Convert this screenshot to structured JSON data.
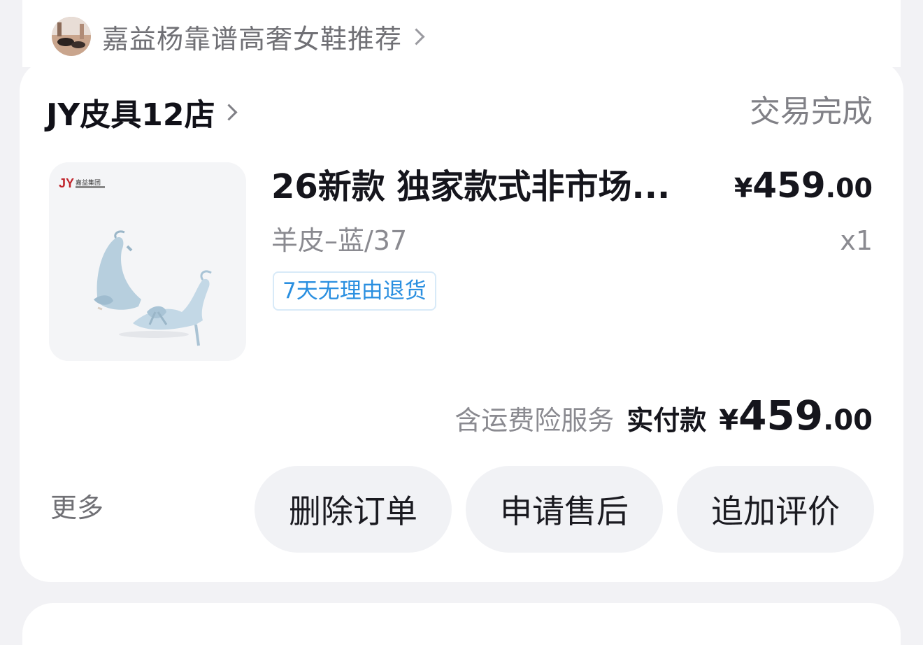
{
  "recommendation": {
    "title": "嘉益杨靠谱高奢女鞋推荐"
  },
  "order": {
    "shop_name": "JY皮具12店",
    "status": "交易完成",
    "product": {
      "title": "26新款 独家款式非市场...",
      "price_symbol": "¥",
      "price_int": "459",
      "price_dec": ".00",
      "spec": "羊皮–蓝/37",
      "quantity": "x1",
      "tag": "7天无理由退货",
      "image_brand": "嘉益集团"
    },
    "total": {
      "note": "含运费险服务",
      "label": "实付款",
      "symbol": "¥",
      "int": "459",
      "dec": ".00"
    },
    "actions": {
      "more": "更多",
      "delete": "删除订单",
      "after_sale": "申请售后",
      "review": "追加评价"
    }
  },
  "colors": {
    "page_bg": "#f2f2f5",
    "card_bg": "#ffffff",
    "tag_text": "#2a8fe0",
    "button_bg": "#f1f2f5"
  }
}
